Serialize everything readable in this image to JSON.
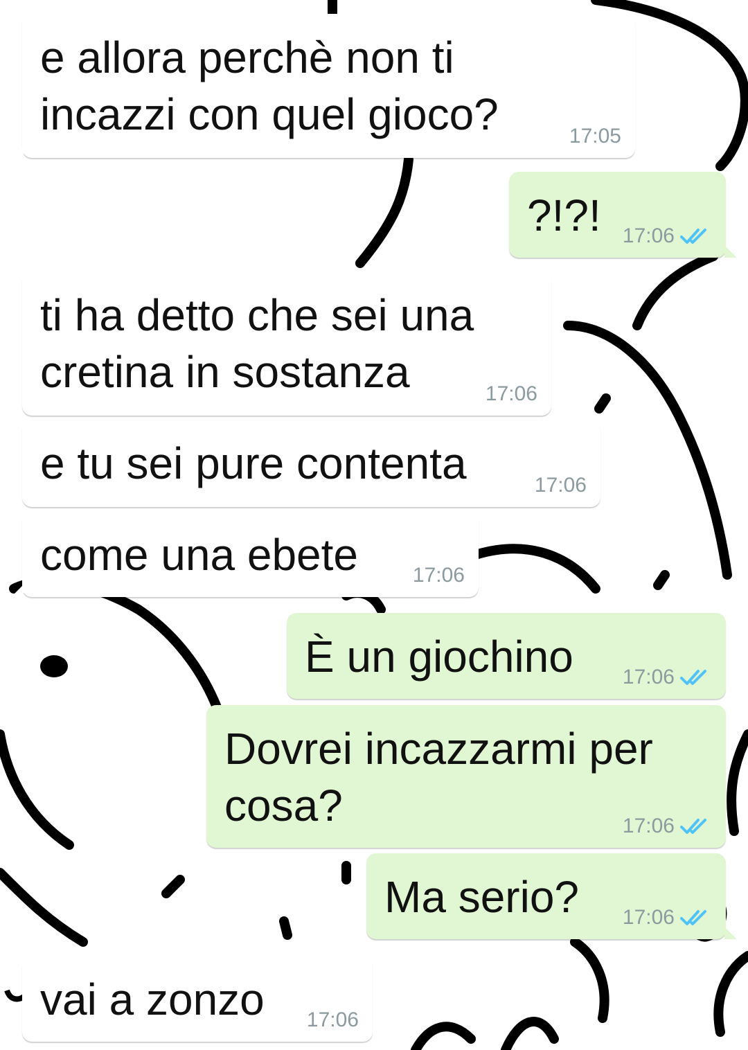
{
  "chat": {
    "accent_tick_color": "#4fc3f7",
    "messages": [
      {
        "dir": "in",
        "text": "e allora perchè non ti incazzi con quel gioco?",
        "line1": "e allora perchè non ti",
        "line2": "incazzi con quel gioco?",
        "time": "17:05"
      },
      {
        "dir": "out",
        "text": "?!?!",
        "time": "17:06",
        "status_icon": "double-check-icon"
      },
      {
        "dir": "in",
        "line1": "ti ha detto che sei una",
        "line2": "cretina in sostanza",
        "time": "17:06"
      },
      {
        "dir": "in",
        "text": "e tu sei pure contenta",
        "time": "17:06"
      },
      {
        "dir": "in",
        "text": "come una ebete",
        "time": "17:06"
      },
      {
        "dir": "out",
        "text": "È un giochino",
        "time": "17:06",
        "status_icon": "double-check-icon"
      },
      {
        "dir": "out",
        "line1": "Dovrei incazzarmi per",
        "line2": "cosa?",
        "time": "17:06",
        "status_icon": "double-check-icon"
      },
      {
        "dir": "out",
        "text": "Ma serio?",
        "time": "17:06",
        "status_icon": "double-check-icon"
      },
      {
        "dir": "in",
        "text": "vai a zonzo",
        "time": "17:06"
      }
    ]
  }
}
